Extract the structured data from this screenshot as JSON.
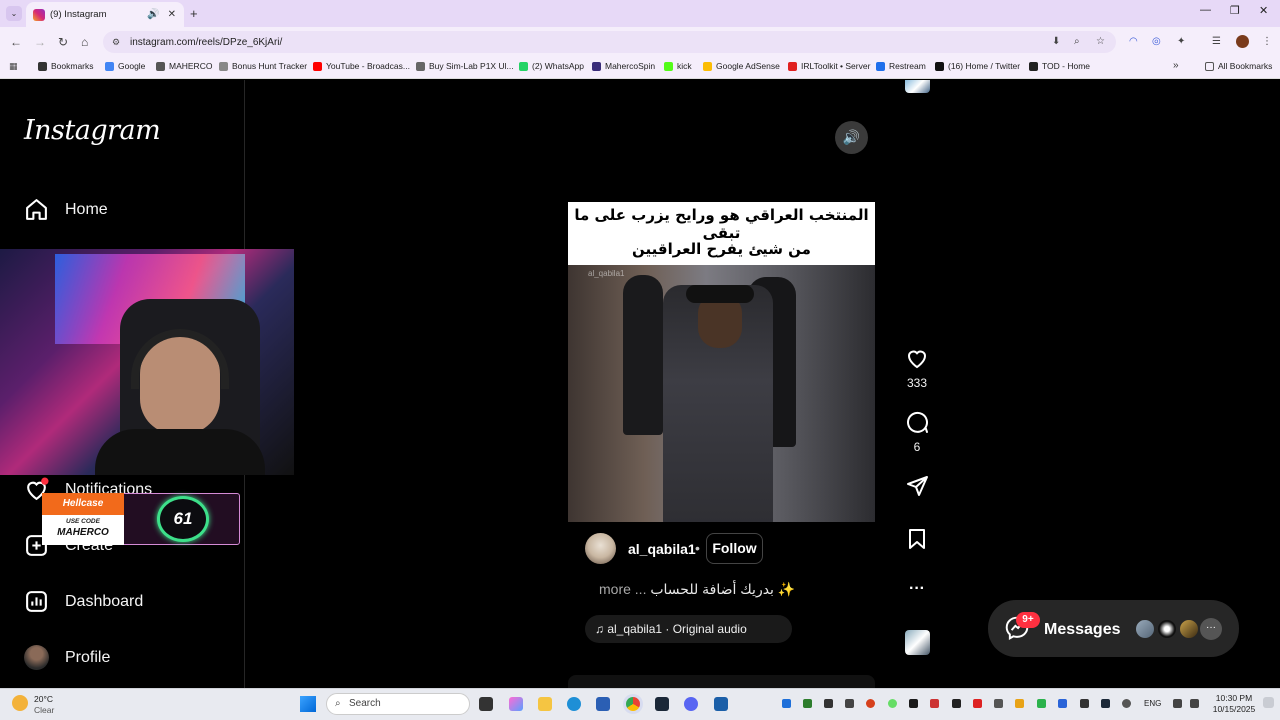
{
  "browser": {
    "tab_title": "(9) Instagram",
    "url": "instagram.com/reels/DPze_6KjAri/",
    "bookmarks": [
      {
        "label": "Bookmarks",
        "color": "#333333"
      },
      {
        "label": "Google",
        "color": "#4285f4"
      },
      {
        "label": "MAHERCO",
        "color": "#555555"
      },
      {
        "label": "Bonus Hunt Tracker",
        "color": "#888888"
      },
      {
        "label": "YouTube - Broadcas...",
        "color": "#ff0000"
      },
      {
        "label": "Buy Sim-Lab P1X Ul...",
        "color": "#666666"
      },
      {
        "label": "(2) WhatsApp",
        "color": "#25d366"
      },
      {
        "label": "MahercoSpin",
        "color": "#3a2c7a"
      },
      {
        "label": "kick",
        "color": "#53fc18"
      },
      {
        "label": "Google AdSense",
        "color": "#fbbc04"
      },
      {
        "label": "IRLToolkit • Server",
        "color": "#e02020"
      },
      {
        "label": "Restream",
        "color": "#1f6feb"
      },
      {
        "label": "(16) Home / Twitter",
        "color": "#111111"
      },
      {
        "label": "TOD - Home",
        "color": "#222222"
      }
    ],
    "all_bookmarks": "All Bookmarks"
  },
  "sidebar": {
    "logo": "Instagram",
    "items": [
      {
        "label": "Home",
        "icon": "home-icon"
      },
      {
        "label": "Notifications",
        "icon": "heart-icon"
      },
      {
        "label": "Create",
        "icon": "plus-square-icon"
      },
      {
        "label": "Dashboard",
        "icon": "dashboard-icon"
      },
      {
        "label": "Profile",
        "icon": "avatar"
      }
    ]
  },
  "overlay": {
    "brand": "Hellcase",
    "use_code_label": "USE CODE",
    "code": "MAHERCO",
    "counter": "61"
  },
  "reel": {
    "caption_line1": "المنتخب العراقي هو ورايح يزرب على ما تبقى",
    "caption_line2": "من شيئ يفرح العراقيين",
    "watermark": "al_qabila1",
    "likes": "333",
    "comments": "6",
    "username": "al_qabila1",
    "follow_label": "Follow",
    "description": "بدريك أضافة للحساب ✨",
    "more_label": "more ...",
    "audio": "al_qabila1 · Original audio"
  },
  "messages": {
    "label": "Messages",
    "badge": "9+"
  },
  "taskbar": {
    "weather_temp": "20°C",
    "weather_desc": "Clear",
    "search_placeholder": "Search",
    "lang": "ENG",
    "time": "10:30 PM",
    "date": "10/15/2025"
  }
}
